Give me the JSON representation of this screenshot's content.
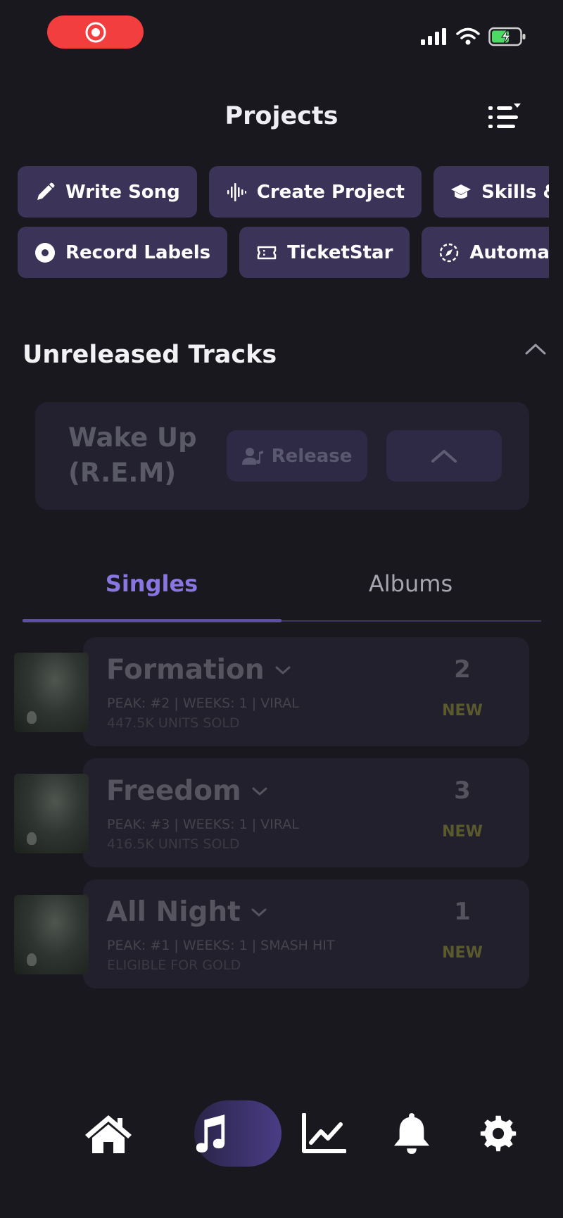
{
  "status_bar": {
    "recording_icon": "record-icon",
    "signal_icon": "signal-icon",
    "wifi_icon": "wifi-icon",
    "battery_icon": "battery-charging-icon"
  },
  "header": {
    "title": "Projects",
    "filter_icon": "filter-list-icon"
  },
  "quick_actions": {
    "row1": [
      {
        "label": "Write Song",
        "icon": "pencil-icon"
      },
      {
        "label": "Create Project",
        "icon": "waveform-icon"
      },
      {
        "label": "Skills & Co",
        "icon": "graduation-cap-icon"
      }
    ],
    "row2": [
      {
        "label": "Record Labels",
        "icon": "vinyl-icon"
      },
      {
        "label": "TicketStar",
        "icon": "ticket-icon"
      },
      {
        "label": "Automated",
        "icon": "compass-icon"
      }
    ]
  },
  "unreleased": {
    "title": "Unreleased Tracks",
    "track": {
      "name_line1": "Wake Up",
      "name_line2": "(R.E.M)",
      "release_label": "Release"
    }
  },
  "tabs": {
    "singles": "Singles",
    "albums": "Albums",
    "active": "Singles"
  },
  "singles": [
    {
      "title": "Formation",
      "meta": "PEAK: #2  | WEEKS: 1 | VIRAL",
      "sub": "447.5K UNITS SOLD",
      "rank": "2",
      "badge": "NEW"
    },
    {
      "title": "Freedom",
      "meta": "PEAK: #3  | WEEKS: 1 | VIRAL",
      "sub": "416.5K UNITS SOLD",
      "rank": "3",
      "badge": "NEW"
    },
    {
      "title": "All Night",
      "meta": "PEAK: #1  | WEEKS: 1 | SMASH HIT",
      "sub": "ELIGIBLE FOR GOLD",
      "rank": "1",
      "badge": "NEW"
    }
  ],
  "bottom_nav": [
    {
      "icon": "home-icon"
    },
    {
      "icon": "music-note-icon",
      "active": true
    },
    {
      "icon": "chart-line-icon"
    },
    {
      "icon": "bell-icon"
    },
    {
      "icon": "gear-icon"
    }
  ],
  "colors": {
    "background": "#19181e",
    "chip": "#3b3358",
    "accent": "#8a76e0",
    "record": "#f23e3e"
  }
}
